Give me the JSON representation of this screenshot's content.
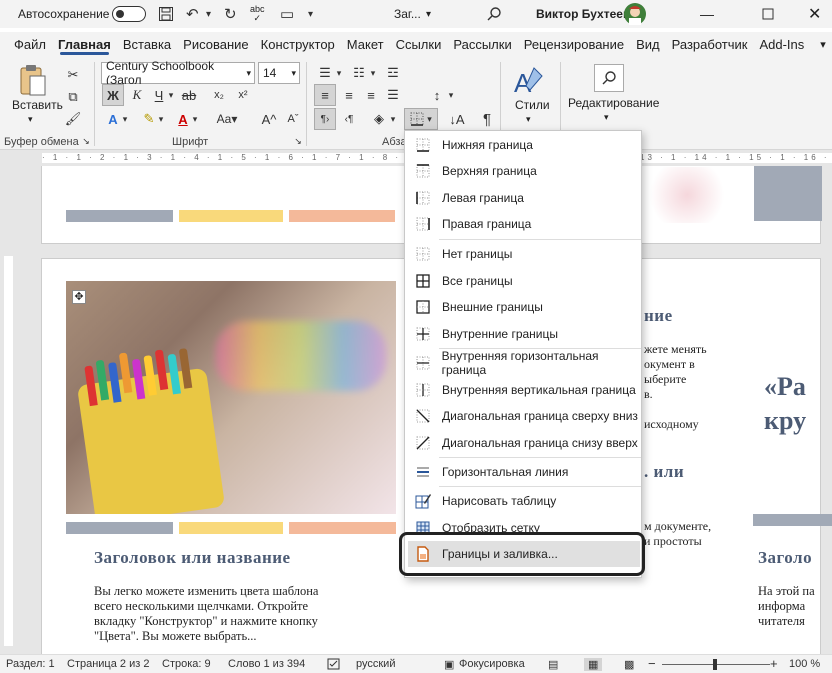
{
  "titlebar": {
    "autosave_label": "Автосохранение",
    "autosave_state": "off",
    "doc_title": "Заг...",
    "user_name": "Виктор Бухтеев",
    "window_controls": [
      "minimize",
      "maximize",
      "close"
    ]
  },
  "menu": {
    "tabs": [
      "Файл",
      "Главная",
      "Вставка",
      "Рисование",
      "Конструктор",
      "Макет",
      "Ссылки",
      "Рассылки",
      "Рецензирование",
      "Вид",
      "Разработчик",
      "Add-Ins"
    ],
    "active": "Главная"
  },
  "ribbon": {
    "paste_label": "Вставить",
    "clipboard_group": "Буфер обмена",
    "font_group": "Шрифт",
    "paragraph_group": "Абза",
    "font_name": "Century Schoolbook (Загол",
    "font_size": "14",
    "bold": "Ж",
    "italic": "К",
    "underline": "Ч",
    "styles_label": "Стили",
    "editing_label": "Редактирование"
  },
  "document": {
    "heading1": "Заголовок или название",
    "heading_right": "Заголо",
    "heading_mid1": "ние",
    "heading_mid2": ". или",
    "body_lines": [
      "Вы легко можете изменить цвета шаблона",
      "всего несколькими щелчками. Откройте",
      "вкладку \"Конструктор\" и нажмите кнопку",
      "\"Цвета\". Вы можете выбрать..."
    ],
    "mid_lines": [
      "жете менять",
      "окумент в",
      "ыберите",
      "в.",
      "",
      "исходному"
    ],
    "mid_lines2": [
      "м документе,",
      "и простоты"
    ],
    "quote_lines": [
      "«Ра",
      "кру"
    ],
    "right_lines": [
      "На этой па",
      "информа",
      "читателя"
    ]
  },
  "dropdown": {
    "items": [
      {
        "label": "Нижняя граница",
        "icon": "border-bottom-icon"
      },
      {
        "label": "Верхняя граница",
        "icon": "border-top-icon"
      },
      {
        "label": "Левая граница",
        "icon": "border-left-icon"
      },
      {
        "label": "Правая граница",
        "icon": "border-right-icon"
      },
      {
        "label": "Нет границы",
        "icon": "border-none-icon"
      },
      {
        "label": "Все границы",
        "icon": "border-all-icon"
      },
      {
        "label": "Внешние границы",
        "icon": "border-outside-icon"
      },
      {
        "label": "Внутренние границы",
        "icon": "border-inside-icon"
      },
      {
        "label": "Внутренняя горизонтальная граница",
        "icon": "border-inside-horizontal-icon"
      },
      {
        "label": "Внутренняя вертикальная граница",
        "icon": "border-inside-vertical-icon"
      },
      {
        "label": "Диагональная граница сверху вниз",
        "icon": "border-diagonal-down-icon"
      },
      {
        "label": "Диагональная граница снизу вверх",
        "icon": "border-diagonal-up-icon"
      },
      {
        "label": "Горизонтальная линия",
        "icon": "horizontal-line-icon"
      },
      {
        "label": "Нарисовать таблицу",
        "icon": "draw-table-icon"
      },
      {
        "label": "Отобразить сетку",
        "icon": "view-gridlines-icon"
      },
      {
        "label": "Границы и заливка...",
        "icon": "borders-shading-icon"
      }
    ]
  },
  "statusbar": {
    "section": "Раздел: 1",
    "page": "Страница 2 из 2",
    "line": "Строка: 9",
    "words": "Слово 1 из 394",
    "language": "русский",
    "focus": "Фокусировка",
    "zoom": "100 %"
  },
  "colors": {
    "accent": "#2b579a",
    "bar_gray": "#a1a9b6",
    "bar_yellow": "#f9d97b",
    "bar_orange": "#f4b99a",
    "heading": "#4c5b74"
  }
}
